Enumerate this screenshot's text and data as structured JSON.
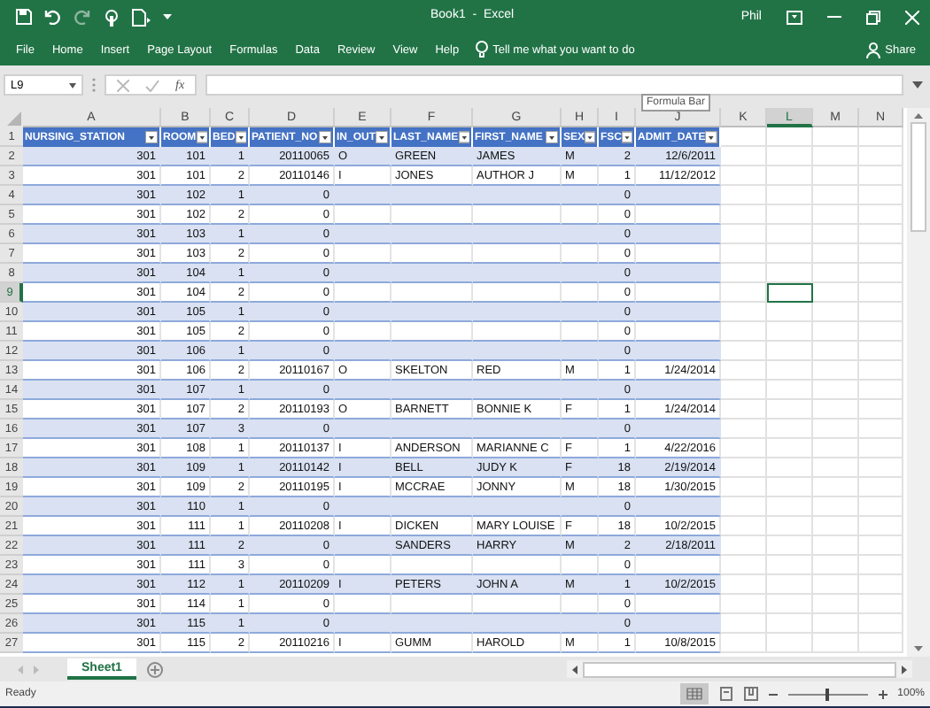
{
  "window": {
    "title": "Book1  -  Excel",
    "user": "Phil"
  },
  "ribbon_tabs": [
    "File",
    "Home",
    "Insert",
    "Page Layout",
    "Formulas",
    "Data",
    "Review",
    "View",
    "Help"
  ],
  "tell_me": {
    "placeholder": "Tell me what you want to do"
  },
  "share": "Share",
  "formula_bar": {
    "name_box": "L9",
    "function_label": "fx",
    "tooltip": "Formula Bar"
  },
  "columns": [
    {
      "letter": "A",
      "selected": false
    },
    {
      "letter": "B",
      "selected": false
    },
    {
      "letter": "C",
      "selected": false
    },
    {
      "letter": "D",
      "selected": false
    },
    {
      "letter": "E",
      "selected": false
    },
    {
      "letter": "F",
      "selected": false
    },
    {
      "letter": "G",
      "selected": false
    },
    {
      "letter": "H",
      "selected": false
    },
    {
      "letter": "I",
      "selected": false
    },
    {
      "letter": "J",
      "selected": false
    },
    {
      "letter": "K",
      "selected": false
    },
    {
      "letter": "L",
      "selected": true
    },
    {
      "letter": "M",
      "selected": false
    },
    {
      "letter": "N",
      "selected": false
    }
  ],
  "table": {
    "header_row_number": "1",
    "headers": [
      "NURSING_STATION",
      "ROOM",
      "BED",
      "PATIENT_NO",
      "IN_OUT",
      "LAST_NAME",
      "FIRST_NAME",
      "SEX",
      "FSC",
      "ADMIT_DATE"
    ],
    "rows": [
      {
        "number": "2",
        "selected": false,
        "cells": [
          "301",
          "101",
          "1",
          "20110065",
          "O",
          "GREEN",
          "JAMES",
          "M",
          "2",
          "12/6/2011"
        ]
      },
      {
        "number": "3",
        "selected": false,
        "cells": [
          "301",
          "101",
          "2",
          "20110146",
          "I",
          "JONES",
          "AUTHOR J",
          "M",
          "1",
          "11/12/2012"
        ]
      },
      {
        "number": "4",
        "selected": false,
        "cells": [
          "301",
          "102",
          "1",
          "0",
          null,
          null,
          null,
          null,
          "0",
          null
        ]
      },
      {
        "number": "5",
        "selected": false,
        "cells": [
          "301",
          "102",
          "2",
          "0",
          null,
          null,
          null,
          null,
          "0",
          null
        ]
      },
      {
        "number": "6",
        "selected": false,
        "cells": [
          "301",
          "103",
          "1",
          "0",
          null,
          null,
          null,
          null,
          "0",
          null
        ]
      },
      {
        "number": "7",
        "selected": false,
        "cells": [
          "301",
          "103",
          "2",
          "0",
          null,
          null,
          null,
          null,
          "0",
          null
        ]
      },
      {
        "number": "8",
        "selected": false,
        "cells": [
          "301",
          "104",
          "1",
          "0",
          null,
          null,
          null,
          null,
          "0",
          null
        ]
      },
      {
        "number": "9",
        "selected": true,
        "cells": [
          "301",
          "104",
          "2",
          "0",
          null,
          null,
          null,
          null,
          "0",
          null
        ]
      },
      {
        "number": "10",
        "selected": false,
        "cells": [
          "301",
          "105",
          "1",
          "0",
          null,
          null,
          null,
          null,
          "0",
          null
        ]
      },
      {
        "number": "11",
        "selected": false,
        "cells": [
          "301",
          "105",
          "2",
          "0",
          null,
          null,
          null,
          null,
          "0",
          null
        ]
      },
      {
        "number": "12",
        "selected": false,
        "cells": [
          "301",
          "106",
          "1",
          "0",
          null,
          null,
          null,
          null,
          "0",
          null
        ]
      },
      {
        "number": "13",
        "selected": false,
        "cells": [
          "301",
          "106",
          "2",
          "20110167",
          "O",
          "SKELTON",
          "RED",
          "M",
          "1",
          "1/24/2014"
        ]
      },
      {
        "number": "14",
        "selected": false,
        "cells": [
          "301",
          "107",
          "1",
          "0",
          null,
          null,
          null,
          null,
          "0",
          null
        ]
      },
      {
        "number": "15",
        "selected": false,
        "cells": [
          "301",
          "107",
          "2",
          "20110193",
          "O",
          "BARNETT",
          "BONNIE K",
          "F",
          "1",
          "1/24/2014"
        ]
      },
      {
        "number": "16",
        "selected": false,
        "cells": [
          "301",
          "107",
          "3",
          "0",
          null,
          null,
          null,
          null,
          "0",
          null
        ]
      },
      {
        "number": "17",
        "selected": false,
        "cells": [
          "301",
          "108",
          "1",
          "20110137",
          "I",
          "ANDERSON",
          "MARIANNE C",
          "F",
          "1",
          "4/22/2016"
        ]
      },
      {
        "number": "18",
        "selected": false,
        "cells": [
          "301",
          "109",
          "1",
          "20110142",
          "I",
          "BELL",
          "JUDY K",
          "F",
          "18",
          "2/19/2014"
        ]
      },
      {
        "number": "19",
        "selected": false,
        "cells": [
          "301",
          "109",
          "2",
          "20110195",
          "I",
          "MCCRAE",
          "JONNY",
          "M",
          "18",
          "1/30/2015"
        ]
      },
      {
        "number": "20",
        "selected": false,
        "cells": [
          "301",
          "110",
          "1",
          "0",
          null,
          null,
          null,
          null,
          "0",
          null
        ]
      },
      {
        "number": "21",
        "selected": false,
        "cells": [
          "301",
          "111",
          "1",
          "20110208",
          "I",
          "DICKEN",
          "MARY LOUISE",
          "F",
          "18",
          "10/2/2015"
        ]
      },
      {
        "number": "22",
        "selected": false,
        "cells": [
          "301",
          "111",
          "2",
          "0",
          null,
          "SANDERS",
          "HARRY",
          "M",
          "2",
          "2/18/2011"
        ]
      },
      {
        "number": "23",
        "selected": false,
        "cells": [
          "301",
          "111",
          "3",
          "0",
          null,
          null,
          null,
          null,
          "0",
          null
        ]
      },
      {
        "number": "24",
        "selected": false,
        "cells": [
          "301",
          "112",
          "1",
          "20110209",
          "I",
          "PETERS",
          "JOHN A",
          "M",
          "1",
          "10/2/2015"
        ]
      },
      {
        "number": "25",
        "selected": false,
        "cells": [
          "301",
          "114",
          "1",
          "0",
          null,
          null,
          null,
          null,
          "0",
          null
        ]
      },
      {
        "number": "26",
        "selected": false,
        "cells": [
          "301",
          "115",
          "1",
          "0",
          null,
          null,
          null,
          null,
          "0",
          null
        ]
      },
      {
        "number": "27",
        "selected": false,
        "cells": [
          "301",
          "115",
          "2",
          "20110216",
          "I",
          "GUMM",
          "HAROLD",
          "M",
          "1",
          "10/8/2015"
        ]
      }
    ]
  },
  "sheet_tabs": [
    {
      "label": "Sheet1",
      "selected": true
    }
  ],
  "status_bar": {
    "text": "Ready",
    "zoom": "100%"
  },
  "zoom_slider": {
    "level": 0.5
  }
}
